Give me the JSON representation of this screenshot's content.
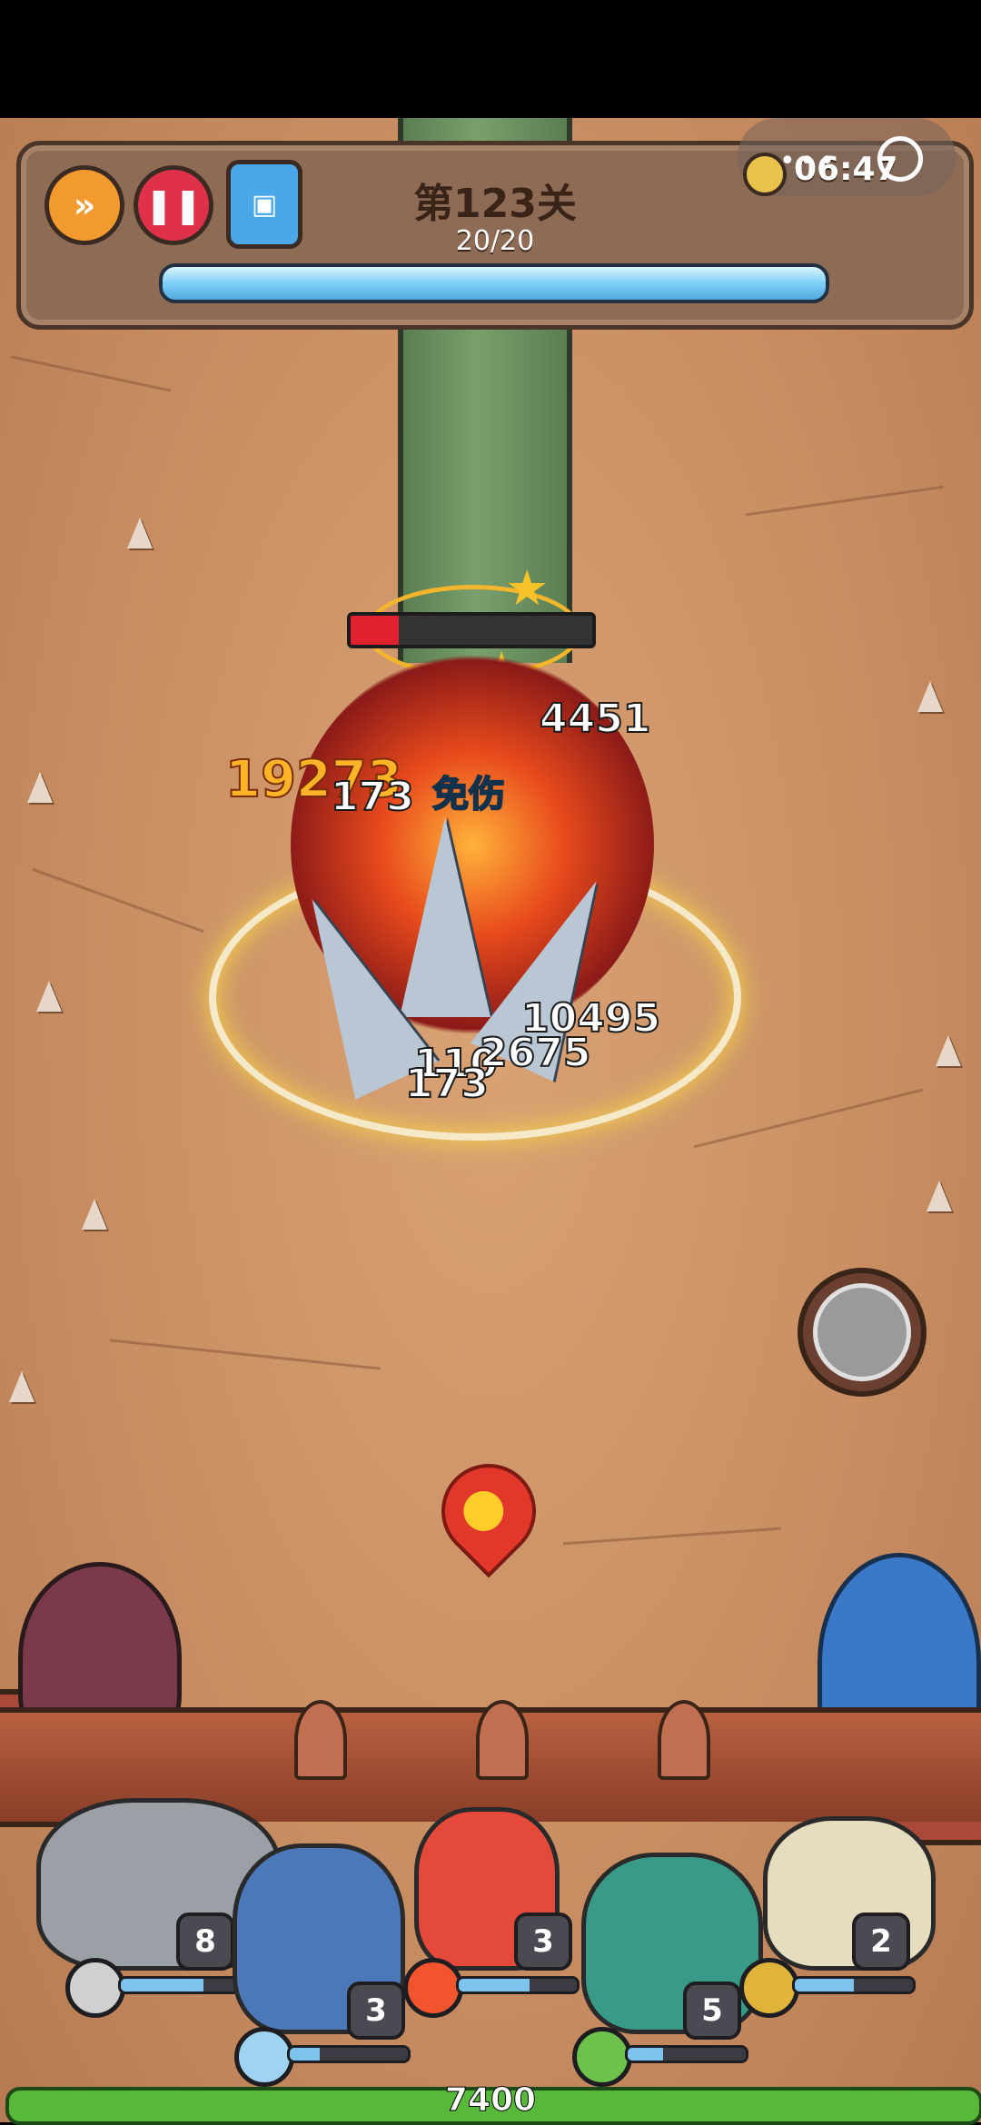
{
  "hud": {
    "level_title": "第123关",
    "wave_progress": "20/20",
    "timer": "06:47",
    "boss_hp_fraction": 0.2
  },
  "damage_numbers": {
    "d1": "4451",
    "d2": "19273",
    "d3": "173",
    "immune": "免伤",
    "d4": "10495",
    "d5": "110",
    "d6": "2675",
    "d7": "173"
  },
  "heroes": [
    {
      "name": "rock-golem",
      "level": "8",
      "mp_fraction": 0.7,
      "color": "#9aa0a6"
    },
    {
      "name": "ice-knight",
      "level": "3",
      "mp_fraction": 0.25,
      "color": "#4a78b8"
    },
    {
      "name": "fire-girl",
      "level": "3",
      "mp_fraction": 0.6,
      "color": "#e4493a"
    },
    {
      "name": "forest-owl",
      "level": "5",
      "mp_fraction": 0.3,
      "color": "#3a9a8a"
    },
    {
      "name": "straw-hat-panda",
      "level": "2",
      "mp_fraction": 0.5,
      "color": "#e6dcc0"
    }
  ],
  "base": {
    "hp_value": "7400",
    "hp_fraction": 1.0
  },
  "colors": {
    "accent_orange": "#f29a2e",
    "pause_red": "#e0314a",
    "hp_red": "#e02230",
    "base_green": "#58b83a"
  }
}
